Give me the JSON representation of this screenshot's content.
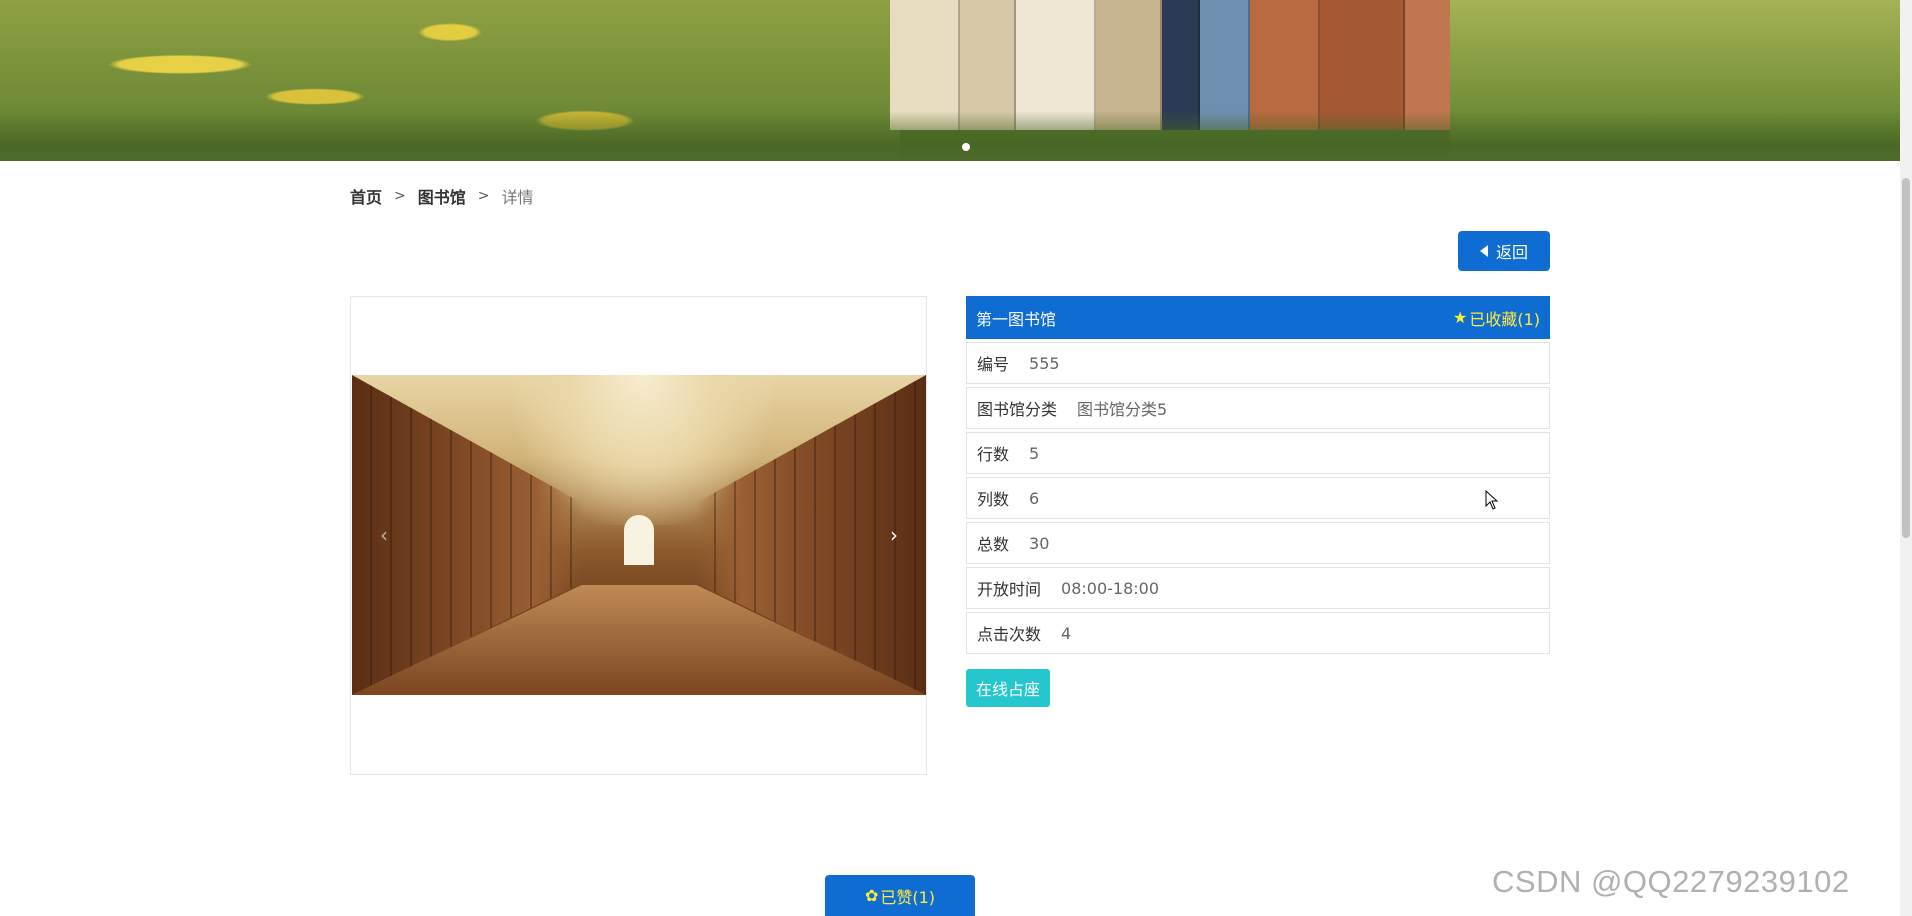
{
  "banner": {
    "active_slide": 1,
    "slide_count": 1
  },
  "breadcrumb": {
    "home": "首页",
    "separator": ">",
    "section": "图书馆",
    "current": "详情"
  },
  "back_button": {
    "label": "返回",
    "icon": "caret-left-icon"
  },
  "carousel": {
    "prev_icon": "‹",
    "next_icon": "›"
  },
  "library": {
    "title": "第一图书馆",
    "favorite_label": "已收藏(1)",
    "favorite_icon": "star-icon",
    "fields": [
      {
        "key": "编号",
        "value": "555"
      },
      {
        "key": "图书馆分类",
        "value": "图书馆分类5"
      },
      {
        "key": "行数",
        "value": "5"
      },
      {
        "key": "列数",
        "value": "6"
      },
      {
        "key": "总数",
        "value": "30"
      },
      {
        "key": "开放时间",
        "value": "08:00-18:00"
      },
      {
        "key": "点击次数",
        "value": "4"
      }
    ]
  },
  "reserve_button": {
    "label": "在线占座"
  },
  "like_button": {
    "label": "已赞(1)",
    "icon": "thumbs-up-icon"
  },
  "watermark": "CSDN @QQ2279239102",
  "colors": {
    "primary": "#0f6cd3",
    "accent_yellow": "#ffeb3b",
    "teal": "#26c6ce"
  }
}
